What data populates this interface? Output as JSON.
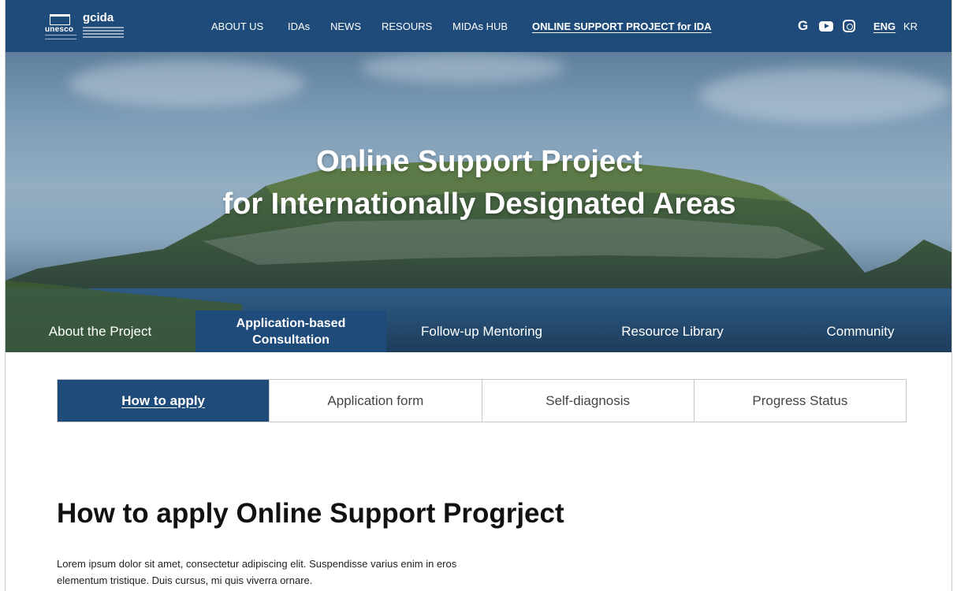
{
  "header": {
    "logo_unesco": "unesco",
    "logo_gcida": "gcida",
    "nav": [
      "ABOUT US",
      "IDAs",
      "NEWS",
      "RESOURS",
      "MIDAs HUB",
      "ONLINE SUPPORT PROJECT for IDA"
    ],
    "social_icons": [
      "google-icon",
      "youtube-icon",
      "instagram-icon"
    ],
    "lang_active": "ENG",
    "lang_other": "KR",
    "accent_color": "#1f4b7a"
  },
  "hero": {
    "title_line1": "Online Support Project",
    "title_line2": "for Internationally Designated Areas"
  },
  "subnav": {
    "items": [
      "About the Project",
      "Application-based Consultation",
      "Follow-up Mentoring",
      "Resource Library",
      "Community"
    ],
    "active_line1": "Application-based",
    "active_line2": "Consultation"
  },
  "tabs": [
    "How to apply",
    "Application form",
    "Self-diagnosis",
    "Progress Status"
  ],
  "main": {
    "title": "How to apply Online Support Progrject",
    "desc_line1": "Lorem ipsum dolor sit amet, consectetur adipiscing elit. Suspendisse varius enim in eros",
    "desc_line2": "elementum tristique. Duis cursus, mi quis viverra ornare."
  }
}
